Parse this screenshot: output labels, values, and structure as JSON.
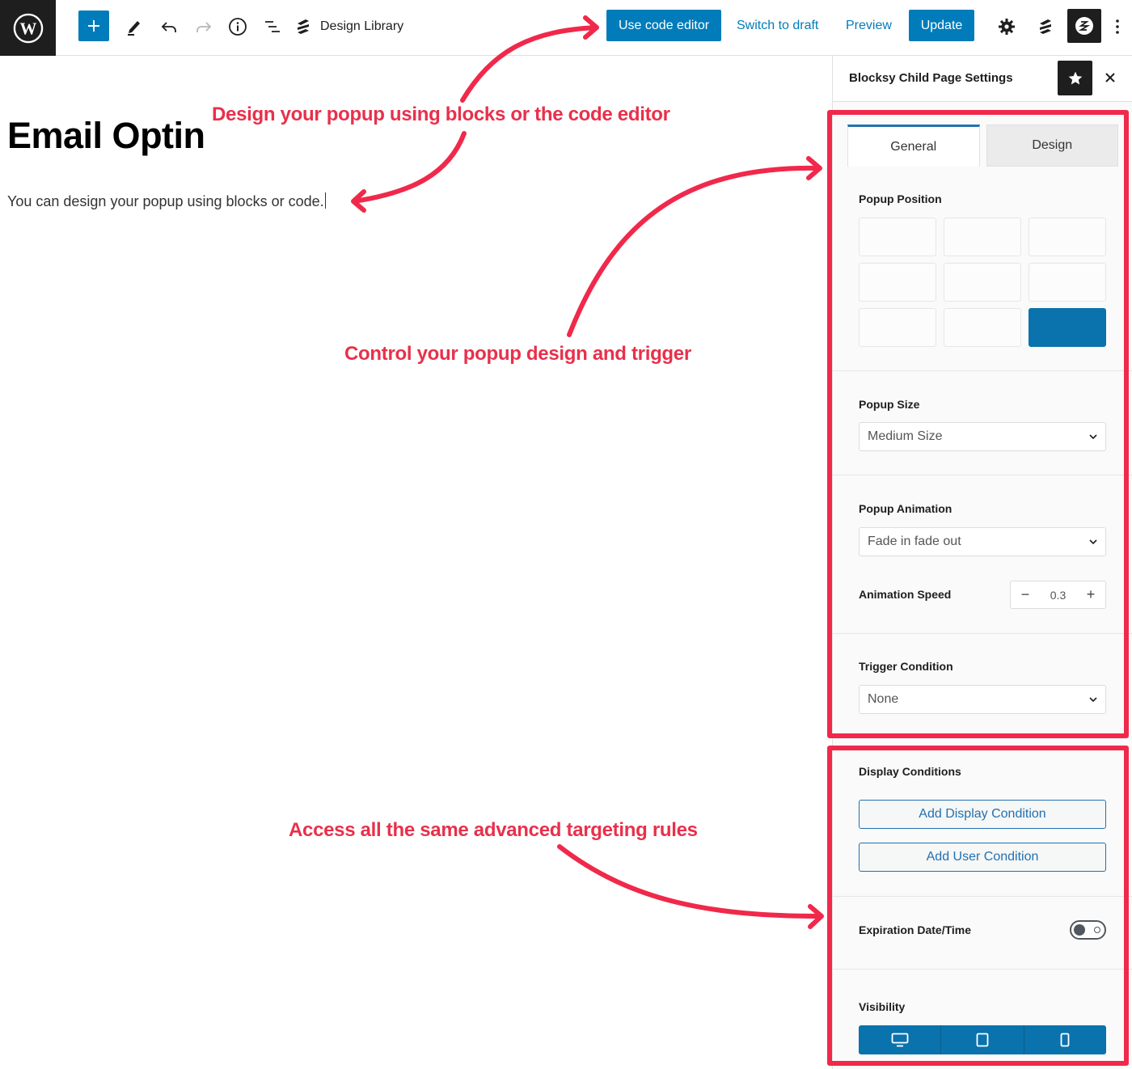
{
  "topbar": {
    "logo": "wordpress-logo",
    "add_block_icon": "plus-icon",
    "tools_icon": "pencil-icon",
    "undo_icon": "undo-icon",
    "redo_icon": "redo-icon",
    "details_icon": "info-icon",
    "outline_icon": "list-view-icon",
    "design_library": {
      "icon": "stackable-icon",
      "label": "Design Library"
    },
    "use_code_editor": "Use code editor",
    "switch_to_draft": "Switch to draft",
    "preview": "Preview",
    "update": "Update",
    "settings_icon": "gear-icon",
    "stackable_icon": "stackable-icon",
    "blocksy_icon": "blocksy-icon",
    "more_icon": "more-vertical-icon"
  },
  "editor": {
    "title": "Email Optin",
    "paragraph": "You can design your popup using blocks or code."
  },
  "annotations": {
    "note1": "Design your popup using blocks or the code editor",
    "note2": "Control your popup design and trigger",
    "note3": "Access all the same advanced targeting rules",
    "color": "#e8304b"
  },
  "sidebar": {
    "title": "Blocksy Child Page Settings",
    "star_icon": "star-icon",
    "close_icon": "close-icon",
    "tabs": [
      {
        "label": "General",
        "active": true
      },
      {
        "label": "Design",
        "active": false
      }
    ],
    "popup_position": {
      "label": "Popup Position",
      "options": [
        "top-left",
        "top-center",
        "top-right",
        "middle-left",
        "center",
        "middle-right",
        "bottom-left",
        "bottom-center",
        "bottom-right"
      ],
      "selected": "bottom-right"
    },
    "popup_size": {
      "label": "Popup Size",
      "value": "Medium Size"
    },
    "popup_animation": {
      "label": "Popup Animation",
      "value": "Fade in fade out"
    },
    "animation_speed": {
      "label": "Animation Speed",
      "value": "0.3",
      "decrement": "−",
      "increment": "+"
    },
    "trigger_condition": {
      "label": "Trigger Condition",
      "value": "None"
    },
    "display_conditions": {
      "label": "Display Conditions",
      "add_display": "Add Display Condition",
      "add_user": "Add User Condition"
    },
    "expiration": {
      "label": "Expiration Date/Time",
      "enabled": false
    },
    "visibility": {
      "label": "Visibility",
      "devices": [
        {
          "name": "desktop",
          "icon": "desktop-icon",
          "active": true
        },
        {
          "name": "tablet",
          "icon": "tablet-icon",
          "active": true
        },
        {
          "name": "mobile",
          "icon": "mobile-icon",
          "active": true
        }
      ]
    }
  },
  "colors": {
    "accent": "#007cba",
    "selected": "#0a72ad",
    "highlight": "#f0294b",
    "dark": "#1e1e1e"
  }
}
